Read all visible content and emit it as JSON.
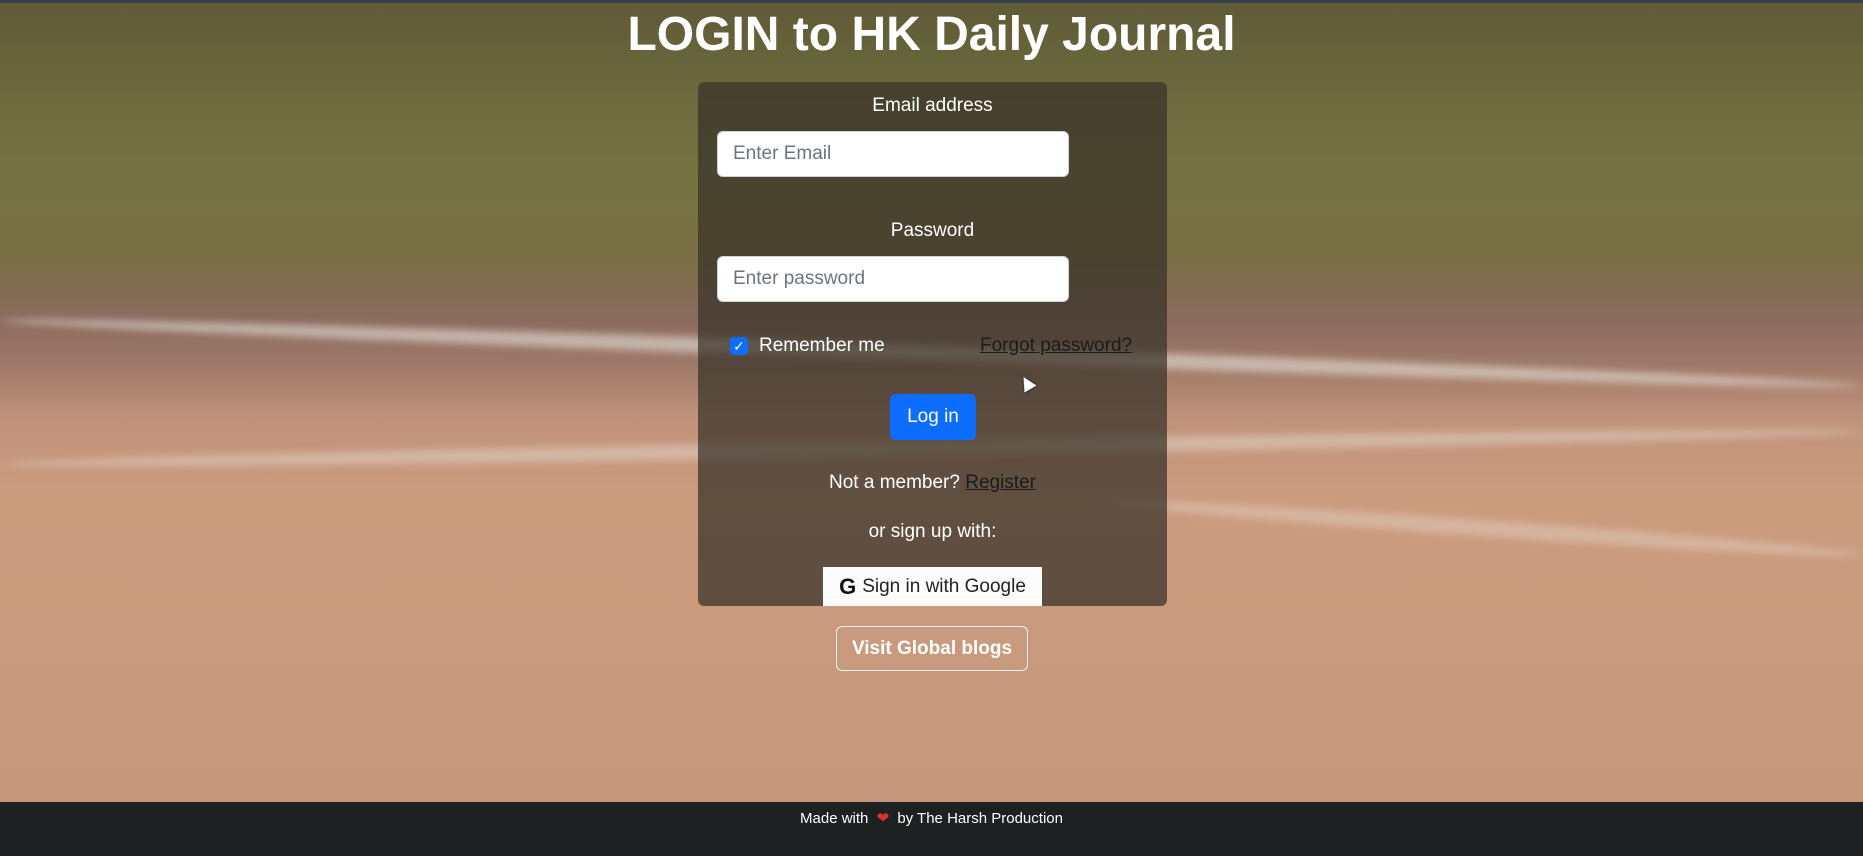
{
  "page": {
    "title": "LOGIN to HK Daily Journal"
  },
  "form": {
    "email_label": "Email address",
    "email_placeholder": "Enter Email",
    "email_value": "",
    "password_label": "Password",
    "password_placeholder": "Enter password",
    "password_value": "",
    "remember_label": "Remember me",
    "remember_checked": true,
    "forgot_label": "Forgot password?",
    "login_label": "Log in",
    "not_member_text": "Not a member?",
    "register_label": "Register",
    "signup_text": "or sign up with:",
    "google_label": "Sign in with Google",
    "google_icon": "google-g-icon"
  },
  "actions": {
    "visit_label": "Visit Global blogs"
  },
  "footer": {
    "made_with": "Made with",
    "heart_icon": "heart-icon",
    "by_text": "by The Harsh Production"
  },
  "colors": {
    "primary": "#0d6efd",
    "card_bg": "rgba(55,50,40,0.72)",
    "footer_bg": "#1e2122"
  }
}
